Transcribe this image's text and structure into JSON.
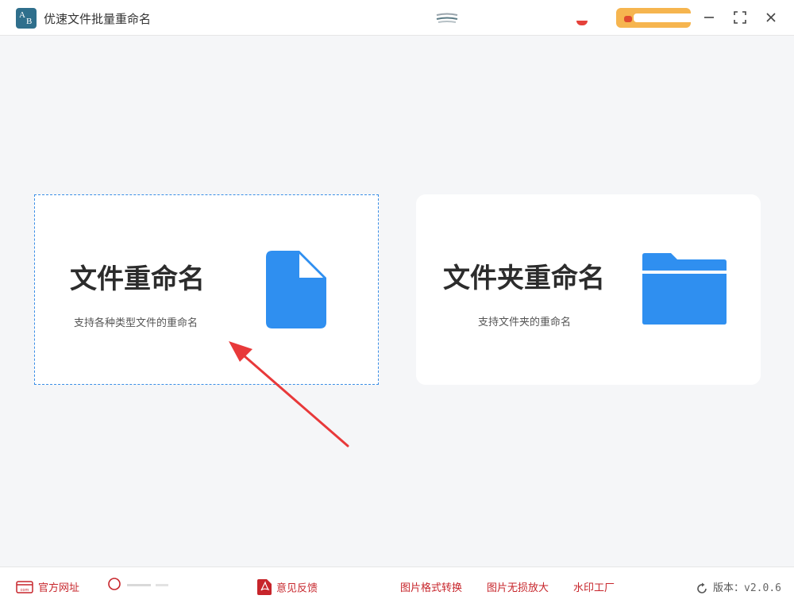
{
  "app": {
    "title": "优速文件批量重命名"
  },
  "colors": {
    "accent": "#3a8ee6",
    "icon_blue": "#2f8ff0",
    "link_red": "#c7252b",
    "promo": "#f6b54f",
    "arrow": "#e8393a"
  },
  "window_controls": [
    {
      "name": "minimize",
      "icon": "minus-icon"
    },
    {
      "name": "maximize",
      "icon": "expand-icon"
    },
    {
      "name": "close",
      "icon": "close-icon"
    }
  ],
  "cards": {
    "file": {
      "title": "文件重命名",
      "desc": "支持各种类型文件的重命名",
      "icon": "file-icon"
    },
    "folder": {
      "title": "文件夹重命名",
      "desc": "支持文件夹的重命名",
      "icon": "folder-icon"
    }
  },
  "footer": {
    "website": "官方网址",
    "feedback": "意见反馈",
    "img_convert": "图片格式转换",
    "img_enlarge": "图片无损放大",
    "watermark": "水印工厂",
    "version_label": "版本：",
    "version_value": "v2.0.6"
  }
}
